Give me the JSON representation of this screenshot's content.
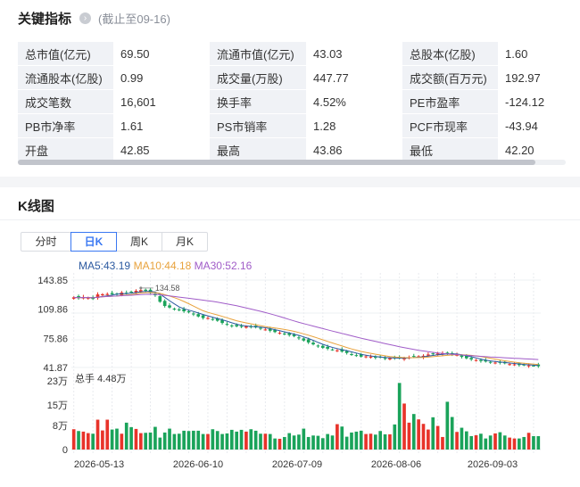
{
  "indicators": {
    "title": "关键指标",
    "info_icon": "chevron-right-icon",
    "as_of": "(截止至09-16)",
    "rows": [
      [
        [
          "总市值(亿元)",
          "69.50"
        ],
        [
          "流通市值(亿元)",
          "43.03"
        ],
        [
          "总股本(亿股)",
          "1.60"
        ]
      ],
      [
        [
          "流通股本(亿股)",
          "0.99"
        ],
        [
          "成交量(万股)",
          "447.77"
        ],
        [
          "成交额(百万元)",
          "192.97"
        ]
      ],
      [
        [
          "成交笔数",
          "16,601"
        ],
        [
          "换手率",
          "4.52%"
        ],
        [
          "PE市盈率",
          "-124.12"
        ]
      ],
      [
        [
          "PB市净率",
          "1.61"
        ],
        [
          "PS市销率",
          "1.28"
        ],
        [
          "PCF市现率",
          "-43.94"
        ]
      ],
      [
        [
          "开盘",
          "42.85"
        ],
        [
          "最高",
          "43.86"
        ],
        [
          "最低",
          "42.20"
        ]
      ]
    ]
  },
  "kline": {
    "title": "K线图",
    "tabs": [
      "分时",
      "日K",
      "周K",
      "月K"
    ],
    "active_tab": "日K",
    "ma": [
      {
        "label": "MA5:43.19",
        "color": "#2c5aa0"
      },
      {
        "label": "MA10:44.18",
        "color": "#e8a23c"
      },
      {
        "label": "MA30:52.16",
        "color": "#a05cc8"
      }
    ],
    "price_ticks": [
      "143.85",
      "109.86",
      "75.86",
      "41.87"
    ],
    "max_marker": "134.58",
    "volume_label": "总手 4.48万",
    "volume_ticks": [
      "23万",
      "15万",
      "8万",
      "0"
    ],
    "dates": [
      "2026-05-13",
      "2026-06-10",
      "2026-07-09",
      "2026-08-06",
      "2026-09-03"
    ],
    "colors": {
      "up": "#e8332a",
      "down": "#1aa35a"
    }
  },
  "chart_data": {
    "type": "candlestick",
    "price_ylim": [
      41.87,
      143.85
    ],
    "volume_ylim": [
      0,
      230000
    ],
    "x_ticks": [
      "2026-05-13",
      "2026-06-10",
      "2026-07-09",
      "2026-08-06",
      "2026-09-03"
    ],
    "close": [
      123.7,
      122.8,
      124.1,
      123.2,
      121.8,
      127.1,
      127.3,
      127.6,
      127.4,
      127.5,
      129.3,
      128.9,
      129.4,
      131.3,
      132.1,
      131.4,
      128.8,
      126.1,
      118.5,
      113.6,
      111.8,
      110.1,
      108.6,
      107.4,
      106.2,
      103.8,
      101.4,
      99.6,
      99.6,
      98.2,
      96.4,
      93.8,
      91.6,
      90.2,
      89.9,
      89.7,
      89.8,
      89.2,
      88.6,
      87.3,
      86.2,
      84.7,
      83.2,
      82.3,
      80.6,
      79.7,
      78.3,
      75.9,
      73.3,
      71.1,
      68.8,
      66.6,
      64.8,
      63.8,
      62.6,
      61.9,
      60.4,
      58.8,
      56.6,
      56.1,
      54.5,
      54.8,
      54.4,
      53.2,
      53.6,
      52.4,
      52.7,
      52.7,
      52.6,
      53.1,
      53.9,
      54.6,
      54.9,
      55.5,
      57.0,
      57.4,
      58.2,
      58.3,
      57.6,
      57.2,
      56.6,
      54.2,
      52.6,
      51.3,
      50.6,
      49.3,
      48.8,
      48.0,
      47.6,
      47.3,
      46.7,
      45.8,
      45.5,
      44.7,
      44.6,
      44.3,
      44.0,
      43.3
    ],
    "volume": [
      68000,
      62000,
      60000,
      55000,
      53000,
      100000,
      64000,
      100000,
      67000,
      70000,
      53000,
      90000,
      75000,
      69000,
      55000,
      56000,
      57000,
      76000,
      40000,
      57000,
      70000,
      52000,
      53000,
      63000,
      62000,
      63000,
      63000,
      52000,
      52000,
      68000,
      62000,
      52000,
      54000,
      66000,
      60000,
      66000,
      60000,
      68000,
      63000,
      53000,
      53000,
      52000,
      37000,
      36000,
      42000,
      55000,
      47000,
      50000,
      70000,
      42000,
      47000,
      46000,
      38000,
      52000,
      47000,
      85000,
      77000,
      43000,
      57000,
      60000,
      63000,
      52000,
      53000,
      50000,
      62000,
      51000,
      51000,
      84000,
      223000,
      154000,
      90000,
      119000,
      101000,
      86000,
      67000,
      108000,
      79000,
      42000,
      160000,
      109000,
      59000,
      73000,
      61000,
      45000,
      48000,
      53000,
      37000,
      47000,
      54000,
      58000,
      47000,
      40000,
      37000,
      37000,
      42000,
      56000,
      45000,
      44800
    ],
    "ma5_last": 43.19,
    "ma10_last": 44.18,
    "ma30_last": 52.16,
    "max_price": 134.58
  }
}
